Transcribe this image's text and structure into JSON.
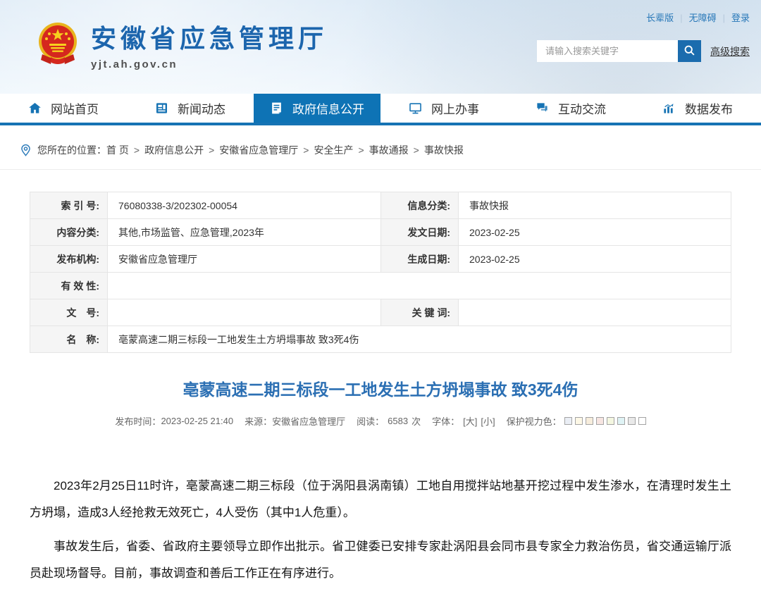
{
  "colors": {
    "accent_blue": "#0e73b5",
    "nav_border_blue": "#1673b4",
    "site_title_blue": "#1c65ad",
    "article_title_blue": "#2b6fb3",
    "search_button_blue": "#1b6cae",
    "label_cell_gray": "#f5f5f5"
  },
  "header": {
    "site_title": "安徽省应急管理厅",
    "site_domain": "yjt.ah.gov.cn",
    "top_links": {
      "elder": "长辈版",
      "accessibility": "无障碍",
      "login": "登录"
    },
    "search": {
      "placeholder": "请输入搜索关键字",
      "advanced_label": "高级搜索",
      "icon": "search-icon"
    }
  },
  "nav": {
    "items": [
      {
        "label": "网站首页",
        "icon": "home-icon",
        "active": false
      },
      {
        "label": "新闻动态",
        "icon": "news-icon",
        "active": false
      },
      {
        "label": "政府信息公开",
        "icon": "document-icon",
        "active": true
      },
      {
        "label": "网上办事",
        "icon": "monitor-icon",
        "active": false
      },
      {
        "label": "互动交流",
        "icon": "chat-icon",
        "active": false
      },
      {
        "label": "数据发布",
        "icon": "chart-icon",
        "active": false
      }
    ]
  },
  "breadcrumb": {
    "icon": "location-pin-icon",
    "prefix": "您所在的位置：",
    "separator": ">",
    "items": [
      "首 页",
      "政府信息公开",
      "安徽省应急管理厅",
      "安全生产",
      "事故通报",
      "事故快报"
    ]
  },
  "doc_table": {
    "index_no": {
      "label": "索 引 号:",
      "value": "76080338-3/202302-00054"
    },
    "info_class": {
      "label": "信息分类:",
      "value": "事故快报"
    },
    "content_class": {
      "label": "内容分类:",
      "value": "其他,市场监管、应急管理,2023年"
    },
    "issue_date": {
      "label": "发文日期:",
      "value": "2023-02-25"
    },
    "publisher": {
      "label": "发布机构:",
      "value": "安徽省应急管理厅"
    },
    "create_date": {
      "label": "生成日期:",
      "value": "2023-02-25"
    },
    "validity": {
      "label": "有 效 性:",
      "value": ""
    },
    "doc_no": {
      "label": "文　号:",
      "value": ""
    },
    "keywords": {
      "label": "关 键 词:",
      "value": ""
    },
    "name": {
      "label": "名　称:",
      "value": "亳蒙高速二期三标段一工地发生土方坍塌事故 致3死4伤"
    }
  },
  "article": {
    "title": "亳蒙高速二期三标段一工地发生土方坍塌事故 致3死4伤",
    "meta": {
      "publish_time_label": "发布时间：",
      "publish_time": "2023-02-25 21:40",
      "source_label": "来源：",
      "source": "安徽省应急管理厅",
      "views_label": "阅读：",
      "views": "6583",
      "views_unit": "次",
      "font_label": "字体：",
      "font_large": "[大]",
      "font_small": "[小]",
      "eye_color_label": "保护视力色：",
      "eye_colors": [
        "#eaeef5",
        "#fdf8e6",
        "#f7eddc",
        "#f7e5e1",
        "#f4f7e1",
        "#dff3f5",
        "#e9e9e9",
        "#ffffff"
      ]
    },
    "paragraphs": [
      "2023年2月25日11时许，亳蒙高速二期三标段（位于涡阳县涡南镇）工地自用搅拌站地基开挖过程中发生渗水，在清理时发生土方坍塌，造成3人经抢救无效死亡，4人受伤（其中1人危重）。",
      "事故发生后，省委、省政府主要领导立即作出批示。省卫健委已安排专家赴涡阳县会同市县专家全力救治伤员，省交通运输厅派员赴现场督导。目前，事故调查和善后工作正在有序进行。"
    ]
  }
}
